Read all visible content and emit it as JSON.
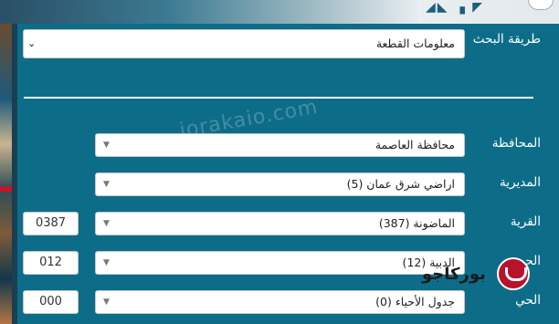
{
  "search": {
    "method_label": "طريقة البحث",
    "method_value": "معلومات القطعة"
  },
  "fields": {
    "governorate": {
      "label": "المحافظة",
      "value": "محافظة العاصمة"
    },
    "directorate": {
      "label": "المديرية",
      "value": "اراضي شرق عمان (5)"
    },
    "village": {
      "label": "القرية",
      "value": "الماضونة (387)",
      "code": "0387"
    },
    "basin": {
      "label": "الحوض",
      "value": "الدبية (12)",
      "code": "012"
    },
    "neighborhood": {
      "label": "الحي",
      "value": "جدول الأحياء (0)",
      "code": "000"
    }
  },
  "watermark": "jorakaio.com",
  "brand": {
    "text": "بوركاجو"
  },
  "colors": {
    "panel": "#0d6d89",
    "logo": "#b7132a"
  }
}
